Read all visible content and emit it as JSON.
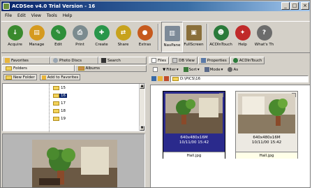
{
  "window": {
    "title": "ACDSee v4.0 Trial Version - 16",
    "buttons": {
      "minimize": "_",
      "maximize": "□",
      "close": "×"
    }
  },
  "menu": [
    "File",
    "Edit",
    "View",
    "Tools",
    "Help"
  ],
  "toolbar": [
    {
      "label": "Acquire",
      "icon": "acquire-icon",
      "color": "#3a8a2e",
      "glyph": "↓"
    },
    {
      "label": "Manage",
      "icon": "manage-icon",
      "color": "#d59a1f",
      "glyph": "▤"
    },
    {
      "label": "Edit",
      "icon": "edit-icon",
      "color": "#2e8f3a",
      "glyph": "✎"
    },
    {
      "label": "Print",
      "icon": "print-icon",
      "color": "#7b8b8f",
      "glyph": "⎙"
    },
    {
      "label": "Create",
      "icon": "create-icon",
      "color": "#29964a",
      "glyph": "✚"
    },
    {
      "label": "Share",
      "icon": "share-icon",
      "color": "#c7a21d",
      "glyph": "⇄"
    },
    {
      "label": "Extras",
      "icon": "extras-icon",
      "color": "#c65a1e",
      "glyph": "●"
    },
    {
      "label": "NavPane",
      "icon": "navpane-icon",
      "color": "#7d8a98",
      "glyph": "▥",
      "active": true
    },
    {
      "label": "FullScreen",
      "icon": "fullscreen-icon",
      "color": "#8a6f3a",
      "glyph": "▣"
    },
    {
      "label": "ACDInTouch",
      "icon": "acdintouch-icon",
      "color": "#2a7a3a",
      "glyph": "☻"
    },
    {
      "label": "Help",
      "icon": "help-icon",
      "color": "#c02a2a",
      "glyph": "✦"
    },
    {
      "label": "What's Th",
      "icon": "whats-this-icon",
      "color": "#6c6c6c",
      "glyph": "?"
    }
  ],
  "left_panel": {
    "tabs": [
      "Favorites",
      "Photo Discs",
      "Search"
    ],
    "subtabs": [
      "Folders",
      "Albums"
    ],
    "folder_buttons": [
      "New Folder",
      "Add to Favorites"
    ],
    "tree": [
      "15",
      "16",
      "17",
      "18",
      "19"
    ]
  },
  "right_panel": {
    "tabs": [
      "Files",
      "DB View",
      "Properties",
      "ACDInTouch"
    ],
    "toolbar": {
      "filter": "Filter",
      "sort": "Sort",
      "mode": "Mode",
      "more": "As"
    },
    "address": "D:\\PICS\\16",
    "thumbnails": [
      {
        "dims": "640x480x16M",
        "date": "10/11/00 15:42",
        "name": "Hall.jpg",
        "selected": true
      },
      {
        "dims": "640x480x16M",
        "date": "10/11/00 15:42",
        "name": "Hall.jpg",
        "selected": false
      }
    ]
  }
}
